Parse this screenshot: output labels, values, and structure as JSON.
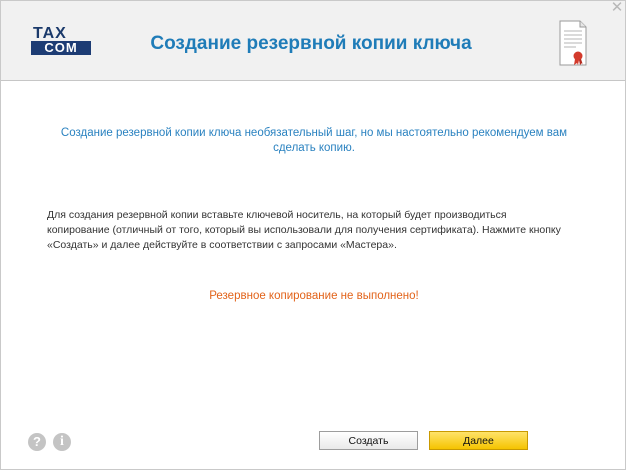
{
  "header": {
    "logo_top": "TAX",
    "logo_bottom": "COM",
    "title": "Создание резервной копии ключа",
    "close_label": "✕"
  },
  "content": {
    "intro": "Создание резервной копии ключа необязательный шаг, но мы настоятельно рекомендуем вам сделать копию.",
    "instructions": "Для создания резервной копии вставьте ключевой носитель, на который будет производиться копирование (отличный от того, который вы использовали для получения сертификата). Нажмите кнопку «Создать» и далее действуйте в соответствии с запросами «Мастера».",
    "status": "Резервное копирование не выполнено!"
  },
  "footer": {
    "help_icon_glyph": "?",
    "info_icon_glyph": "i",
    "create_label": "Создать",
    "next_label": "Далее"
  },
  "colors": {
    "title": "#1f7cb8",
    "intro": "#2a82c0",
    "status": "#e2631a",
    "next_button": "#f5c400"
  },
  "icons": [
    "certificate-icon",
    "close-icon",
    "help-icon",
    "info-icon"
  ]
}
